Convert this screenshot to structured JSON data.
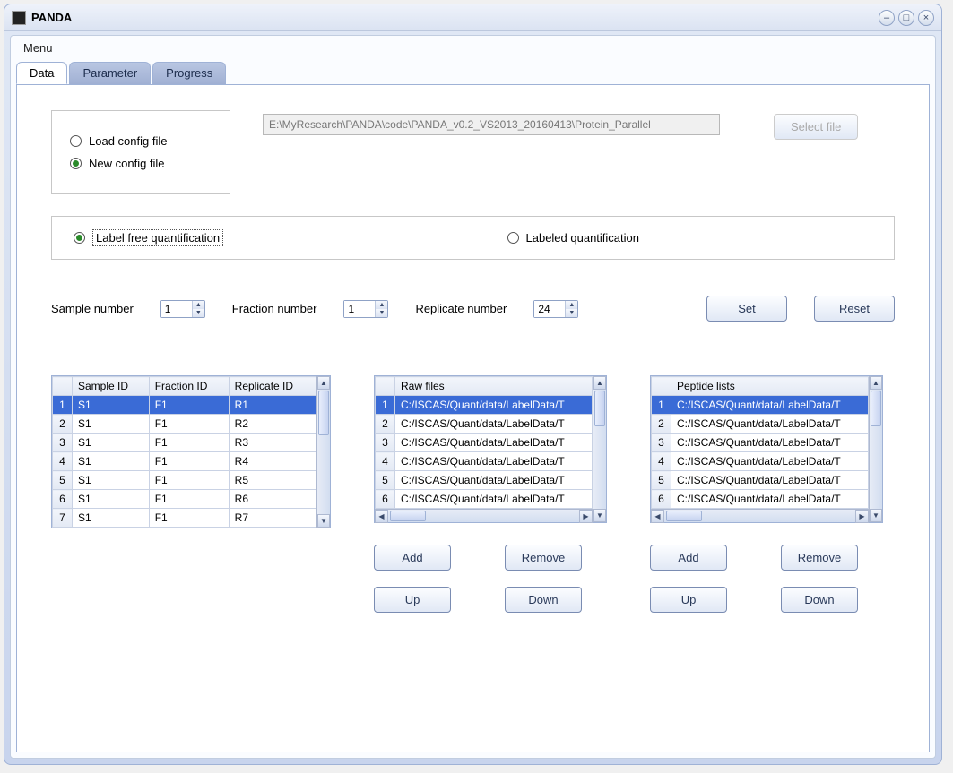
{
  "window": {
    "title": "PANDA"
  },
  "menubar": {
    "menu": "Menu"
  },
  "tabs": {
    "data": "Data",
    "parameter": "Parameter",
    "progress": "Progress"
  },
  "config": {
    "load_label": "Load config file",
    "new_label": "New config file",
    "path": "E:\\MyResearch\\PANDA\\code\\PANDA_v0.2_VS2013_20160413\\Protein_Parallel",
    "select_file": "Select file"
  },
  "quant": {
    "label_free": "Label free quantification",
    "labeled": "Labeled quantification"
  },
  "numbers": {
    "sample_label": "Sample number",
    "sample_value": "1",
    "fraction_label": "Fraction number",
    "fraction_value": "1",
    "replicate_label": "Replicate number",
    "replicate_value": "24",
    "set": "Set",
    "reset": "Reset"
  },
  "samples_table": {
    "headers": [
      "Sample ID",
      "Fraction ID",
      "Replicate ID"
    ],
    "rows": [
      {
        "n": "1",
        "sample": "S1",
        "fraction": "F1",
        "replicate": "R1",
        "selected": true
      },
      {
        "n": "2",
        "sample": "S1",
        "fraction": "F1",
        "replicate": "R2"
      },
      {
        "n": "3",
        "sample": "S1",
        "fraction": "F1",
        "replicate": "R3"
      },
      {
        "n": "4",
        "sample": "S1",
        "fraction": "F1",
        "replicate": "R4"
      },
      {
        "n": "5",
        "sample": "S1",
        "fraction": "F1",
        "replicate": "R5"
      },
      {
        "n": "6",
        "sample": "S1",
        "fraction": "F1",
        "replicate": "R6"
      },
      {
        "n": "7",
        "sample": "S1",
        "fraction": "F1",
        "replicate": "R7"
      }
    ]
  },
  "raw_files": {
    "header": "Raw files",
    "rows": [
      {
        "n": "1",
        "path": "C:/ISCAS/Quant/data/LabelData/T",
        "selected": true
      },
      {
        "n": "2",
        "path": "C:/ISCAS/Quant/data/LabelData/T"
      },
      {
        "n": "3",
        "path": "C:/ISCAS/Quant/data/LabelData/T"
      },
      {
        "n": "4",
        "path": "C:/ISCAS/Quant/data/LabelData/T"
      },
      {
        "n": "5",
        "path": "C:/ISCAS/Quant/data/LabelData/T"
      },
      {
        "n": "6",
        "path": "C:/ISCAS/Quant/data/LabelData/T"
      }
    ],
    "add": "Add",
    "remove": "Remove",
    "up": "Up",
    "down": "Down"
  },
  "peptide_lists": {
    "header": "Peptide lists",
    "rows": [
      {
        "n": "1",
        "path": "C:/ISCAS/Quant/data/LabelData/T",
        "selected": true
      },
      {
        "n": "2",
        "path": "C:/ISCAS/Quant/data/LabelData/T"
      },
      {
        "n": "3",
        "path": "C:/ISCAS/Quant/data/LabelData/T"
      },
      {
        "n": "4",
        "path": "C:/ISCAS/Quant/data/LabelData/T"
      },
      {
        "n": "5",
        "path": "C:/ISCAS/Quant/data/LabelData/T"
      },
      {
        "n": "6",
        "path": "C:/ISCAS/Quant/data/LabelData/T"
      }
    ],
    "add": "Add",
    "remove": "Remove",
    "up": "Up",
    "down": "Down"
  }
}
